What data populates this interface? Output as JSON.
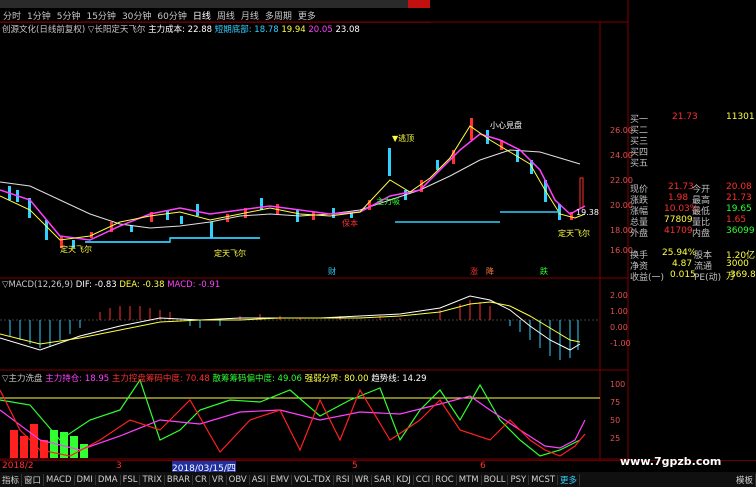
{
  "timeframes": [
    "分时",
    "1分钟",
    "5分钟",
    "15分钟",
    "30分钟",
    "60分钟",
    "日线",
    "周线",
    "月线",
    "多周期",
    "更多"
  ],
  "active_tf": "日线",
  "main": {
    "stock": "创源文化(日线前复权)",
    "indicator": "▽长阳定天飞尔",
    "cost_label": "主力成本:",
    "cost_value": "22.88",
    "short_label": "短期底部:",
    "short_v1": "18.78",
    "short_v2": "19.94",
    "short_v3": "20.05",
    "short_v4": "23.08",
    "yticks": [
      "26.00",
      "24.00",
      "22.00",
      "20.00",
      "18.00",
      "16.00"
    ],
    "annotations": {
      "top": "▼逃顶",
      "xiaoxin": "小心見盘",
      "bottom1": "定天飞尔",
      "bottom2": "定天飞尔",
      "bottom3": "定天飞尔",
      "zhu": "主力吸",
      "baoben": "保本"
    },
    "last_price_tag": "19.38",
    "markers": {
      "cai": "财",
      "zhang": "涨",
      "jiang": "降",
      "die": "跌"
    }
  },
  "macd": {
    "label": "▽MACD(12,26,9)",
    "dif": "DIF: -0.83",
    "dea": "DEA: -0.38",
    "macd": "MACD: -0.91",
    "yticks": [
      "2.00",
      "1.00",
      "0.00",
      "-1.00"
    ]
  },
  "third": {
    "label": "▽主力洗盘",
    "a": "主力持仓: 18.95",
    "b": "主力控盘筹码中度: 70.48",
    "c": "散筹筹码偏中度: 49.06",
    "d": "强弱分界: 80.00",
    "e": "趋势线: 14.29",
    "yticks": [
      "100",
      "75",
      "50",
      "25"
    ]
  },
  "quote": {
    "rows": [
      {
        "l": "买一",
        "v": "21.73",
        "r": "11301"
      },
      {
        "l": "买二",
        "v": "",
        "r": ""
      },
      {
        "l": "买三",
        "v": "",
        "r": ""
      },
      {
        "l": "买四",
        "v": "",
        "r": ""
      },
      {
        "l": "买五",
        "v": "",
        "r": ""
      }
    ],
    "stats": [
      {
        "l": "现价",
        "v": "21.73",
        "m": "今开",
        "r": "20.08"
      },
      {
        "l": "涨跌",
        "v": "1.98",
        "m": "最高",
        "r": "21.73"
      },
      {
        "l": "涨幅",
        "v": "10.03%",
        "m": "最低",
        "r": "19.65"
      },
      {
        "l": "总量",
        "v": "77809",
        "m": "量比",
        "r": "1.65"
      },
      {
        "l": "外盘",
        "v": "41709",
        "m": "内盘",
        "r": "36099"
      },
      {
        "l": "换手",
        "v": "25.94%",
        "m": "股本",
        "r": "1.20亿"
      },
      {
        "l": "净资",
        "v": "4.87",
        "m": "流通",
        "r": "3000万"
      },
      {
        "l": "收益(一)",
        "v": "0.015",
        "m": "PE(动)",
        "r": "369.8"
      }
    ]
  },
  "axis": {
    "d1": "2018/2",
    "d2": "3",
    "d3": "2018/03/15/四",
    "d4": "5",
    "d5": "6"
  },
  "tabs": [
    "指标",
    "窗口",
    "MACD",
    "DMI",
    "DMA",
    "FSL",
    "TRIX",
    "BRAR",
    "CR",
    "VR",
    "OBV",
    "ASI",
    "EMV",
    "VOL-TDX",
    "RSI",
    "WR",
    "SAR",
    "KDJ",
    "CCI",
    "ROC",
    "MTM",
    "BOLL",
    "PSY",
    "MCST",
    "更多",
    "模板"
  ],
  "watermark": "www.7gpzb.com",
  "colors": {
    "up": "#ff3030",
    "down": "#30d0ff",
    "ma": "#ffffff",
    "mag": "#ff40ff",
    "yellow": "#ffff40",
    "green": "#30ff30"
  }
}
